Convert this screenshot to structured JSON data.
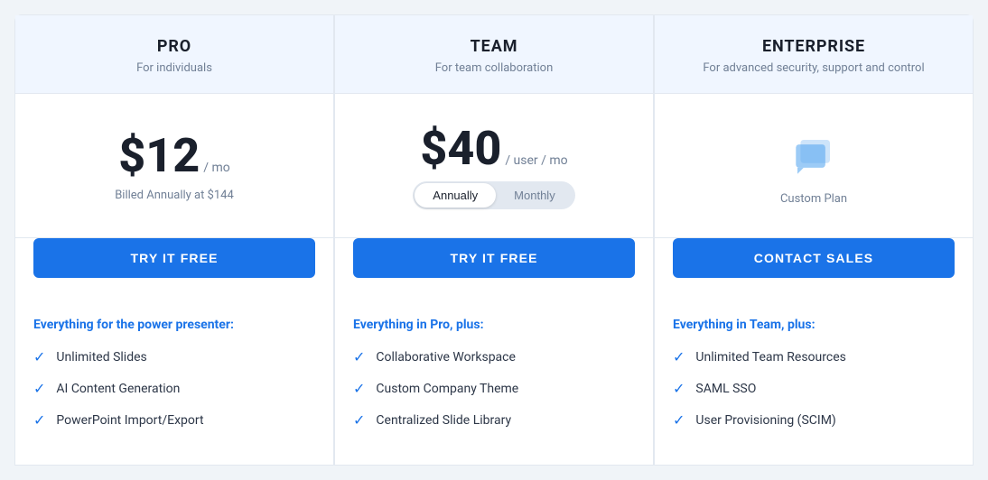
{
  "plans": [
    {
      "id": "pro",
      "name": "PRO",
      "tagline": "For individuals",
      "price": "$12",
      "price_unit": "/ mo",
      "billed_note": "Billed Annually at $144",
      "cta_label": "TRY IT FREE",
      "cta_type": "blue",
      "features_title": "Everything for the power presenter:",
      "features": [
        "Unlimited Slides",
        "AI Content Generation",
        "PowerPoint Import/Export"
      ],
      "has_toggle": false,
      "has_custom": false
    },
    {
      "id": "team",
      "name": "TEAM",
      "tagline": "For team collaboration",
      "price": "$40",
      "price_unit": "/ user / mo",
      "billed_note": "",
      "cta_label": "TRY IT FREE",
      "cta_type": "blue",
      "features_title": "Everything in Pro, plus:",
      "features": [
        "Collaborative Workspace",
        "Custom Company Theme",
        "Centralized Slide Library"
      ],
      "has_toggle": true,
      "has_custom": false,
      "toggle": {
        "annually_label": "Annually",
        "monthly_label": "Monthly",
        "active": "annually"
      }
    },
    {
      "id": "enterprise",
      "name": "ENTERPRISE",
      "tagline": "For advanced security, support and control",
      "price": "",
      "price_unit": "",
      "billed_note": "",
      "cta_label": "CONTACT SALES",
      "cta_type": "blue",
      "features_title": "Everything in Team, plus:",
      "features": [
        "Unlimited Team Resources",
        "SAML SSO",
        "User Provisioning (SCIM)"
      ],
      "has_toggle": false,
      "has_custom": true,
      "custom_plan_label": "Custom Plan"
    }
  ],
  "icons": {
    "check": "✓",
    "chat": "💬"
  }
}
